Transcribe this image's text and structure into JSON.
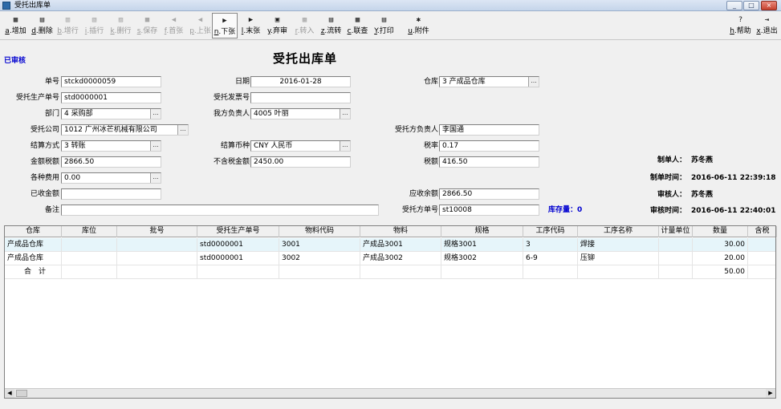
{
  "window": {
    "title": "受托出库单",
    "min": "_",
    "max": "□",
    "close": "×"
  },
  "toolbar": [
    {
      "key": "a",
      "label": "增加",
      "icon": "▦",
      "enabled": true
    },
    {
      "key": "d",
      "label": "删除",
      "icon": "▤",
      "enabled": true
    },
    {
      "key": "b",
      "label": "增行",
      "icon": "▥",
      "enabled": false
    },
    {
      "key": "i",
      "label": "插行",
      "icon": "▧",
      "enabled": false
    },
    {
      "key": "k",
      "label": "删行",
      "icon": "▨",
      "enabled": false
    },
    {
      "key": "s",
      "label": "保存",
      "icon": "■",
      "enabled": false
    },
    {
      "key": "f",
      "label": "首张",
      "icon": "◀",
      "enabled": false
    },
    {
      "key": "p",
      "label": "上张",
      "icon": "◀",
      "enabled": false
    },
    {
      "key": "n",
      "label": "下张",
      "icon": "▶",
      "enabled": true
    },
    {
      "key": "l",
      "label": "末张",
      "icon": "▶",
      "enabled": true
    },
    {
      "key": "y",
      "label": "弃审",
      "icon": "▣",
      "enabled": true
    },
    {
      "key": "r",
      "label": "转入",
      "icon": "▩",
      "enabled": false
    },
    {
      "key": "z",
      "label": "流转",
      "icon": "▤",
      "enabled": true
    },
    {
      "key": "c",
      "label": "联查",
      "icon": "▦",
      "enabled": true
    },
    {
      "key": "Y",
      "label": "打印",
      "icon": "▤",
      "enabled": true
    },
    {
      "key": "u",
      "label": "附件",
      "icon": "✱",
      "enabled": true
    },
    {
      "key": "h",
      "label": "帮助",
      "icon": "?",
      "enabled": true
    },
    {
      "key": "x",
      "label": "退出",
      "icon": "⇥",
      "enabled": true
    }
  ],
  "status": "已审核",
  "form_title": "受托出库单",
  "fields": {
    "order_no": {
      "label": "单号",
      "value": "stckd0000059"
    },
    "date": {
      "label": "日期",
      "value": "2016-01-28"
    },
    "warehouse": {
      "label": "仓库",
      "value": "3 产成品仓库"
    },
    "prod_order": {
      "label": "受托生产单号",
      "value": "std0000001"
    },
    "invoice_no": {
      "label": "受托发票号",
      "value": ""
    },
    "department": {
      "label": "部门",
      "value": "4 采购部"
    },
    "our_person": {
      "label": "我方负责人",
      "value": "4005 叶丽"
    },
    "client_company": {
      "label": "受托公司",
      "value": "1012 广州冰芒机械有限公司"
    },
    "client_person": {
      "label": "受托方负责人",
      "value": "李国通"
    },
    "settle_method": {
      "label": "结算方式",
      "value": "3 转账"
    },
    "currency": {
      "label": "结算币种",
      "value": "CNY 人民币"
    },
    "tax_rate": {
      "label": "税率",
      "value": "0.17"
    },
    "amount_tax": {
      "label": "金额税额",
      "value": "2866.50"
    },
    "amount_notax": {
      "label": "不含税金额",
      "value": "2450.00"
    },
    "tax": {
      "label": "税额",
      "value": "416.50"
    },
    "fees": {
      "label": "各种费用",
      "value": "0.00"
    },
    "received": {
      "label": "已收金额",
      "value": ""
    },
    "receivable": {
      "label": "应收余额",
      "value": "2866.50"
    },
    "remark": {
      "label": "备注",
      "value": ""
    },
    "client_order": {
      "label": "受托方单号",
      "value": "st10008"
    }
  },
  "stock_label": "库存量：0",
  "info": {
    "creator_label": "制单人：",
    "creator": "苏冬燕",
    "create_time_label": "制单时间：",
    "create_time": "2016-06-11 22:39:18",
    "auditor_label": "审核人：",
    "auditor": "苏冬燕",
    "audit_time_label": "审核时间：",
    "audit_time": "2016-06-11 22:40:01"
  },
  "grid": {
    "columns": [
      "仓库",
      "库位",
      "批号",
      "受托生产单号",
      "物料代码",
      "物料",
      "规格",
      "工序代码",
      "工序名称",
      "计量单位",
      "数量",
      "含税"
    ],
    "rows": [
      [
        "产成品仓库",
        "",
        "",
        "std0000001",
        "3001",
        "产成品3001",
        "规格3001",
        "3",
        "焊接",
        "",
        "30.00",
        ""
      ],
      [
        "产成品仓库",
        "",
        "",
        "std0000001",
        "3002",
        "产成品3002",
        "规格3002",
        "6-9",
        "压铆",
        "",
        "20.00",
        ""
      ]
    ],
    "total_label": "合　计",
    "total_qty": "50.00"
  }
}
